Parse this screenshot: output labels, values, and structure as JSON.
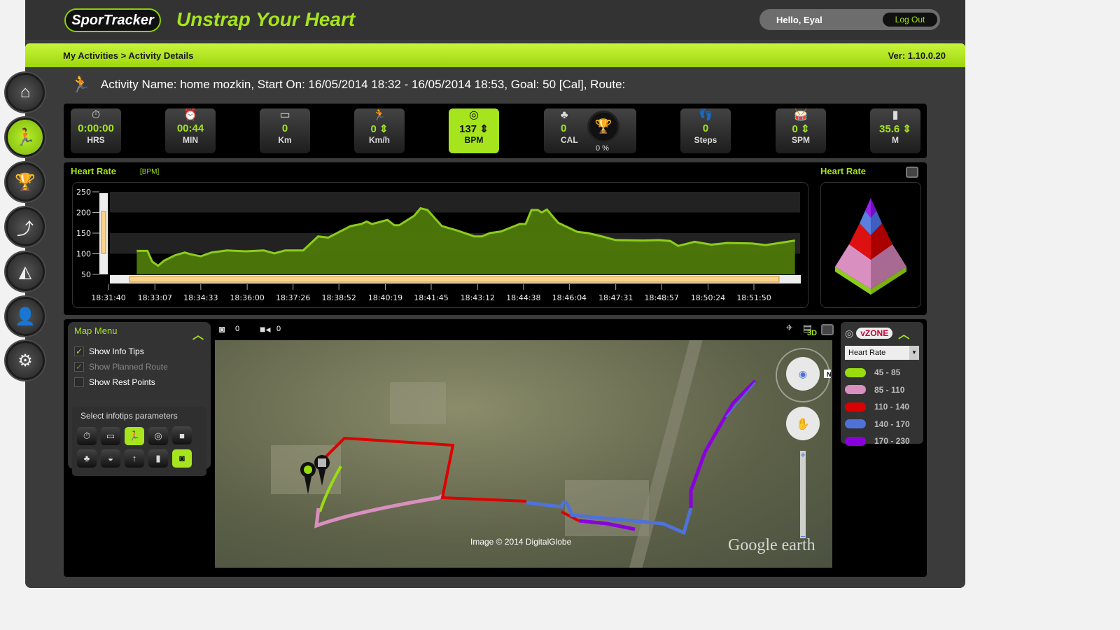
{
  "header": {
    "logo": "SporTracker",
    "slogan": "Unstrap Your Heart",
    "greeting": "Hello, Eyal",
    "logout": "Log Out"
  },
  "nav": {
    "breadcrumb": "My Activities > Activity Details",
    "version": "Ver: 1.10.0.20"
  },
  "sidebar": [
    {
      "icon": "home-icon",
      "glyph": "⌂"
    },
    {
      "icon": "runner-icon",
      "glyph": "🏃",
      "active": true
    },
    {
      "icon": "trophy-icon",
      "glyph": "🏆"
    },
    {
      "icon": "route-icon",
      "glyph": "⤴"
    },
    {
      "icon": "chart-icon",
      "glyph": "◭"
    },
    {
      "icon": "user-icon",
      "glyph": "👤"
    },
    {
      "icon": "gear-icon",
      "glyph": "⚙"
    }
  ],
  "activity": {
    "line": "Activity Name: home mozkin, Start On: 16/05/2014 18:32 - 16/05/2014 18:53, Goal: 50 [Cal], Route:"
  },
  "stats": [
    {
      "icon": "stopwatch-icon",
      "glyph": "⏱",
      "value": "0:00:00",
      "unit": "HRS"
    },
    {
      "icon": "alarm-icon",
      "glyph": "⏰",
      "value": "00:44",
      "unit": "MIN"
    },
    {
      "icon": "ruler-icon",
      "glyph": "▭",
      "value": "0",
      "unit": "Km"
    },
    {
      "icon": "speed-runner-icon",
      "glyph": "🏃",
      "value": "0 ⇕",
      "unit": "Km/h"
    },
    {
      "icon": "heart-icon",
      "glyph": "◎",
      "value": "137 ⇕",
      "unit": "BPM",
      "active": true
    },
    {
      "icon": "calories-icon",
      "glyph": "♣",
      "value": "0",
      "unit": "CAL"
    },
    {
      "icon": "steps-icon",
      "glyph": "👣",
      "value": "0",
      "unit": "Steps"
    },
    {
      "icon": "drum-icon",
      "glyph": "🥁",
      "value": "0 ⇕",
      "unit": "SPM"
    },
    {
      "icon": "altitude-icon",
      "glyph": "▮",
      "value": "35.6 ⇕",
      "unit": "M"
    }
  ],
  "goal": {
    "percent": "0 %",
    "value": 0
  },
  "chart": {
    "title": "Heart Rate",
    "unit": "[BPM]",
    "pyramid_title": "Heart Rate"
  },
  "chart_data": {
    "type": "area",
    "title": "Heart Rate",
    "ylabel": "[BPM]",
    "ylim": [
      50,
      250
    ],
    "yticks": [
      50,
      100,
      150,
      200,
      250
    ],
    "xticks": [
      "18:31:40",
      "18:33:07",
      "18:34:33",
      "18:36:00",
      "18:37:26",
      "18:38:52",
      "18:40:19",
      "18:41:45",
      "18:43:12",
      "18:44:38",
      "18:46:04",
      "18:47:31",
      "18:48:57",
      "18:50:24",
      "18:51:50"
    ],
    "xlim": [
      "18:31:40",
      "18:53:07"
    ],
    "color": "#8ccc1a",
    "grid": "bands",
    "points": [
      [
        "18:32:33",
        107
      ],
      [
        "18:32:53",
        107
      ],
      [
        "18:33:02",
        81
      ],
      [
        "18:33:13",
        71
      ],
      [
        "18:33:24",
        83
      ],
      [
        "18:33:44",
        96
      ],
      [
        "18:34:03",
        103
      ],
      [
        "18:34:13",
        99
      ],
      [
        "18:34:33",
        94
      ],
      [
        "18:34:53",
        103
      ],
      [
        "18:35:22",
        108
      ],
      [
        "18:35:57",
        106
      ],
      [
        "18:36:31",
        108
      ],
      [
        "18:36:51",
        101
      ],
      [
        "18:37:11",
        108
      ],
      [
        "18:37:45",
        108
      ],
      [
        "18:38:13",
        142
      ],
      [
        "18:38:32",
        139
      ],
      [
        "18:39:14",
        167
      ],
      [
        "18:39:34",
        172
      ],
      [
        "18:39:44",
        178
      ],
      [
        "18:39:54",
        172
      ],
      [
        "18:40:23",
        182
      ],
      [
        "18:40:36",
        169
      ],
      [
        "18:40:45",
        169
      ],
      [
        "18:41:13",
        192
      ],
      [
        "18:41:25",
        210
      ],
      [
        "18:41:38",
        206
      ],
      [
        "18:42:05",
        167
      ],
      [
        "18:42:32",
        157
      ],
      [
        "18:43:06",
        142
      ],
      [
        "18:43:20",
        142
      ],
      [
        "18:43:35",
        150
      ],
      [
        "18:43:56",
        154
      ],
      [
        "18:44:31",
        172
      ],
      [
        "18:44:42",
        172
      ],
      [
        "18:44:53",
        206
      ],
      [
        "18:45:05",
        206
      ],
      [
        "18:45:12",
        200
      ],
      [
        "18:45:22",
        207
      ],
      [
        "18:45:43",
        175
      ],
      [
        "18:46:19",
        153
      ],
      [
        "18:46:39",
        150
      ],
      [
        "18:47:05",
        142
      ],
      [
        "18:47:31",
        133
      ],
      [
        "18:48:22",
        132
      ],
      [
        "18:48:52",
        133
      ],
      [
        "18:49:13",
        131
      ],
      [
        "18:49:28",
        119
      ],
      [
        "18:49:59",
        129
      ],
      [
        "18:50:30",
        122
      ],
      [
        "18:51:00",
        126
      ],
      [
        "18:51:46",
        125
      ],
      [
        "18:52:12",
        121
      ],
      [
        "18:53:07",
        132
      ]
    ]
  },
  "map": {
    "menu_title": "Map Menu",
    "options": [
      {
        "label": "Show Info Tips",
        "checked": true
      },
      {
        "label": "Show Planned Route",
        "checked": true,
        "disabled": true
      },
      {
        "label": "Show Rest Points",
        "checked": false
      }
    ],
    "infotips_label": "Select infotips parameters",
    "photo_count": "0",
    "video_count": "0",
    "credit": "Image © 2014 DigitalGlobe",
    "brand": "Google earth",
    "compass": "N",
    "view_3d": "3D"
  },
  "zones": {
    "logo": "vZONE",
    "selected": "Heart Rate",
    "items": [
      {
        "range": "45 - 85",
        "color": "#99dd11"
      },
      {
        "range": "85 - 110",
        "color": "#d98fbf"
      },
      {
        "range": "110 - 140",
        "color": "#dd0000"
      },
      {
        "range": "140 - 170",
        "color": "#4f72d9"
      },
      {
        "range": "170 - 230",
        "color": "#8a00dd"
      }
    ]
  }
}
